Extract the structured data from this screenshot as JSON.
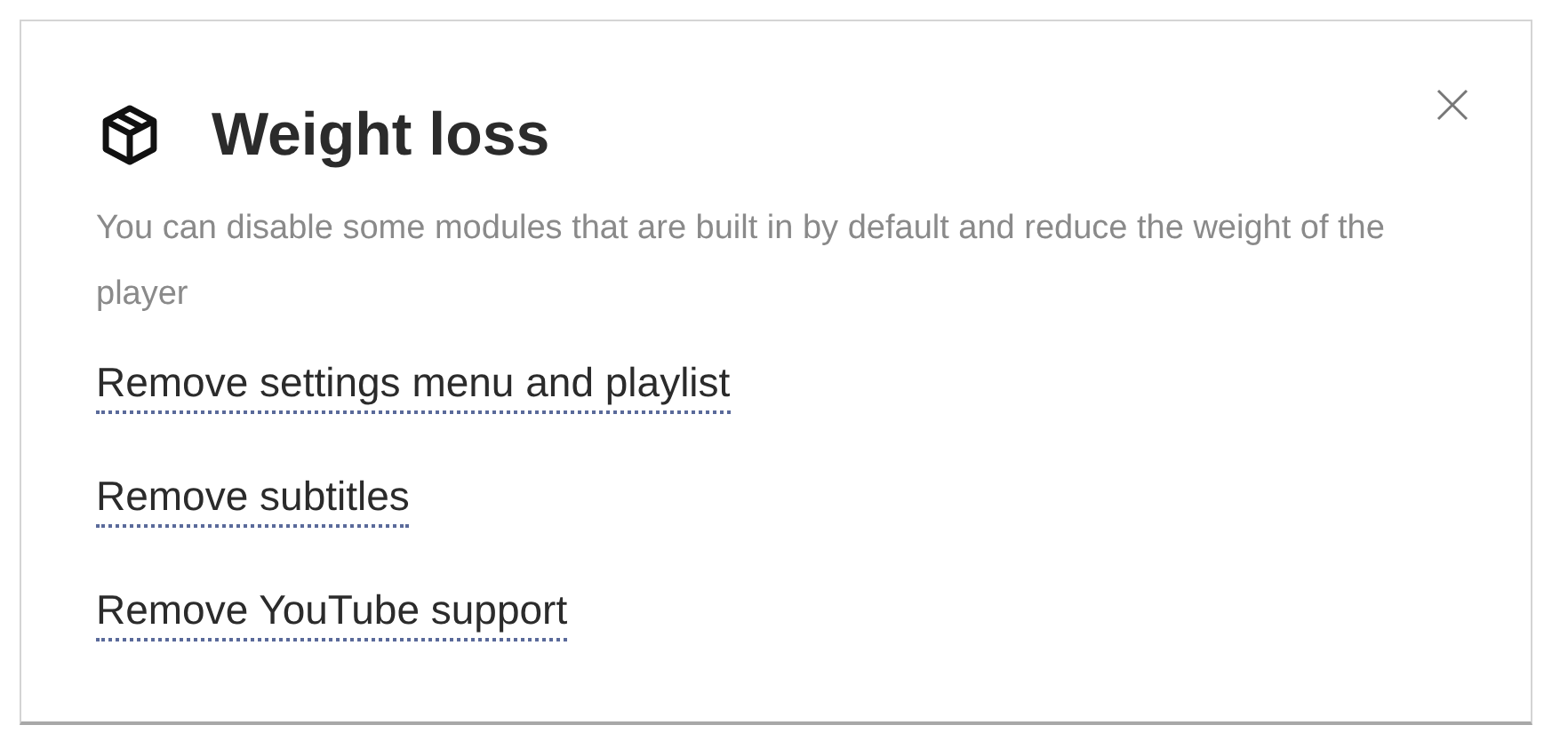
{
  "dialog": {
    "title": "Weight loss",
    "description": "You can disable some modules that are built in by default and reduce the weight of the player",
    "options": [
      {
        "label": "Remove settings menu and playlist"
      },
      {
        "label": "Remove subtitles"
      },
      {
        "label": "Remove YouTube support"
      }
    ]
  }
}
